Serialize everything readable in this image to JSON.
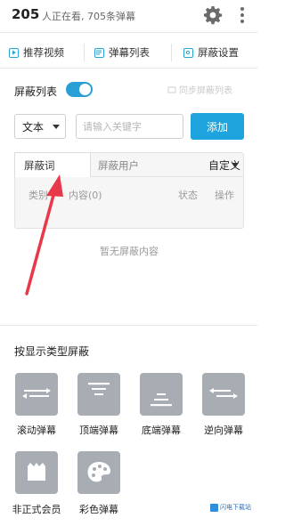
{
  "header": {
    "viewer_count": "205",
    "viewer_text": "人正在看, 705条弹幕"
  },
  "tabs": [
    {
      "label": "推荐视频"
    },
    {
      "label": "弹幕列表"
    },
    {
      "label": "屏蔽设置"
    }
  ],
  "block_list": {
    "label": "屏蔽列表",
    "enabled": true,
    "sync_label": "同步屏蔽列表"
  },
  "filter": {
    "type_value": "文本",
    "keyword_placeholder": "请输入关键字",
    "add_label": "添加"
  },
  "subtabs": {
    "words": "屏蔽词",
    "users": "屏蔽用户",
    "custom": "自定义"
  },
  "table": {
    "col_type": "类别",
    "col_content": "内容(0)",
    "col_status": "状态",
    "col_action": "操作",
    "empty_text": "暂无屏蔽内容"
  },
  "type_block": {
    "title": "按显示类型屏蔽",
    "items": [
      {
        "label": "滚动弹幕",
        "icon": "scroll-danmaku-icon"
      },
      {
        "label": "顶端弹幕",
        "icon": "top-danmaku-icon"
      },
      {
        "label": "底端弹幕",
        "icon": "bottom-danmaku-icon"
      },
      {
        "label": "逆向弹幕",
        "icon": "reverse-danmaku-icon"
      },
      {
        "label": "非正式会员",
        "icon": "guest-member-icon"
      },
      {
        "label": "彩色弹幕",
        "icon": "color-palette-icon"
      }
    ]
  },
  "watermark": {
    "text": "闪电下载站"
  },
  "colors": {
    "accent": "#1fa3dc",
    "tile": "#a8adb3",
    "arrow": "#e8394a"
  }
}
